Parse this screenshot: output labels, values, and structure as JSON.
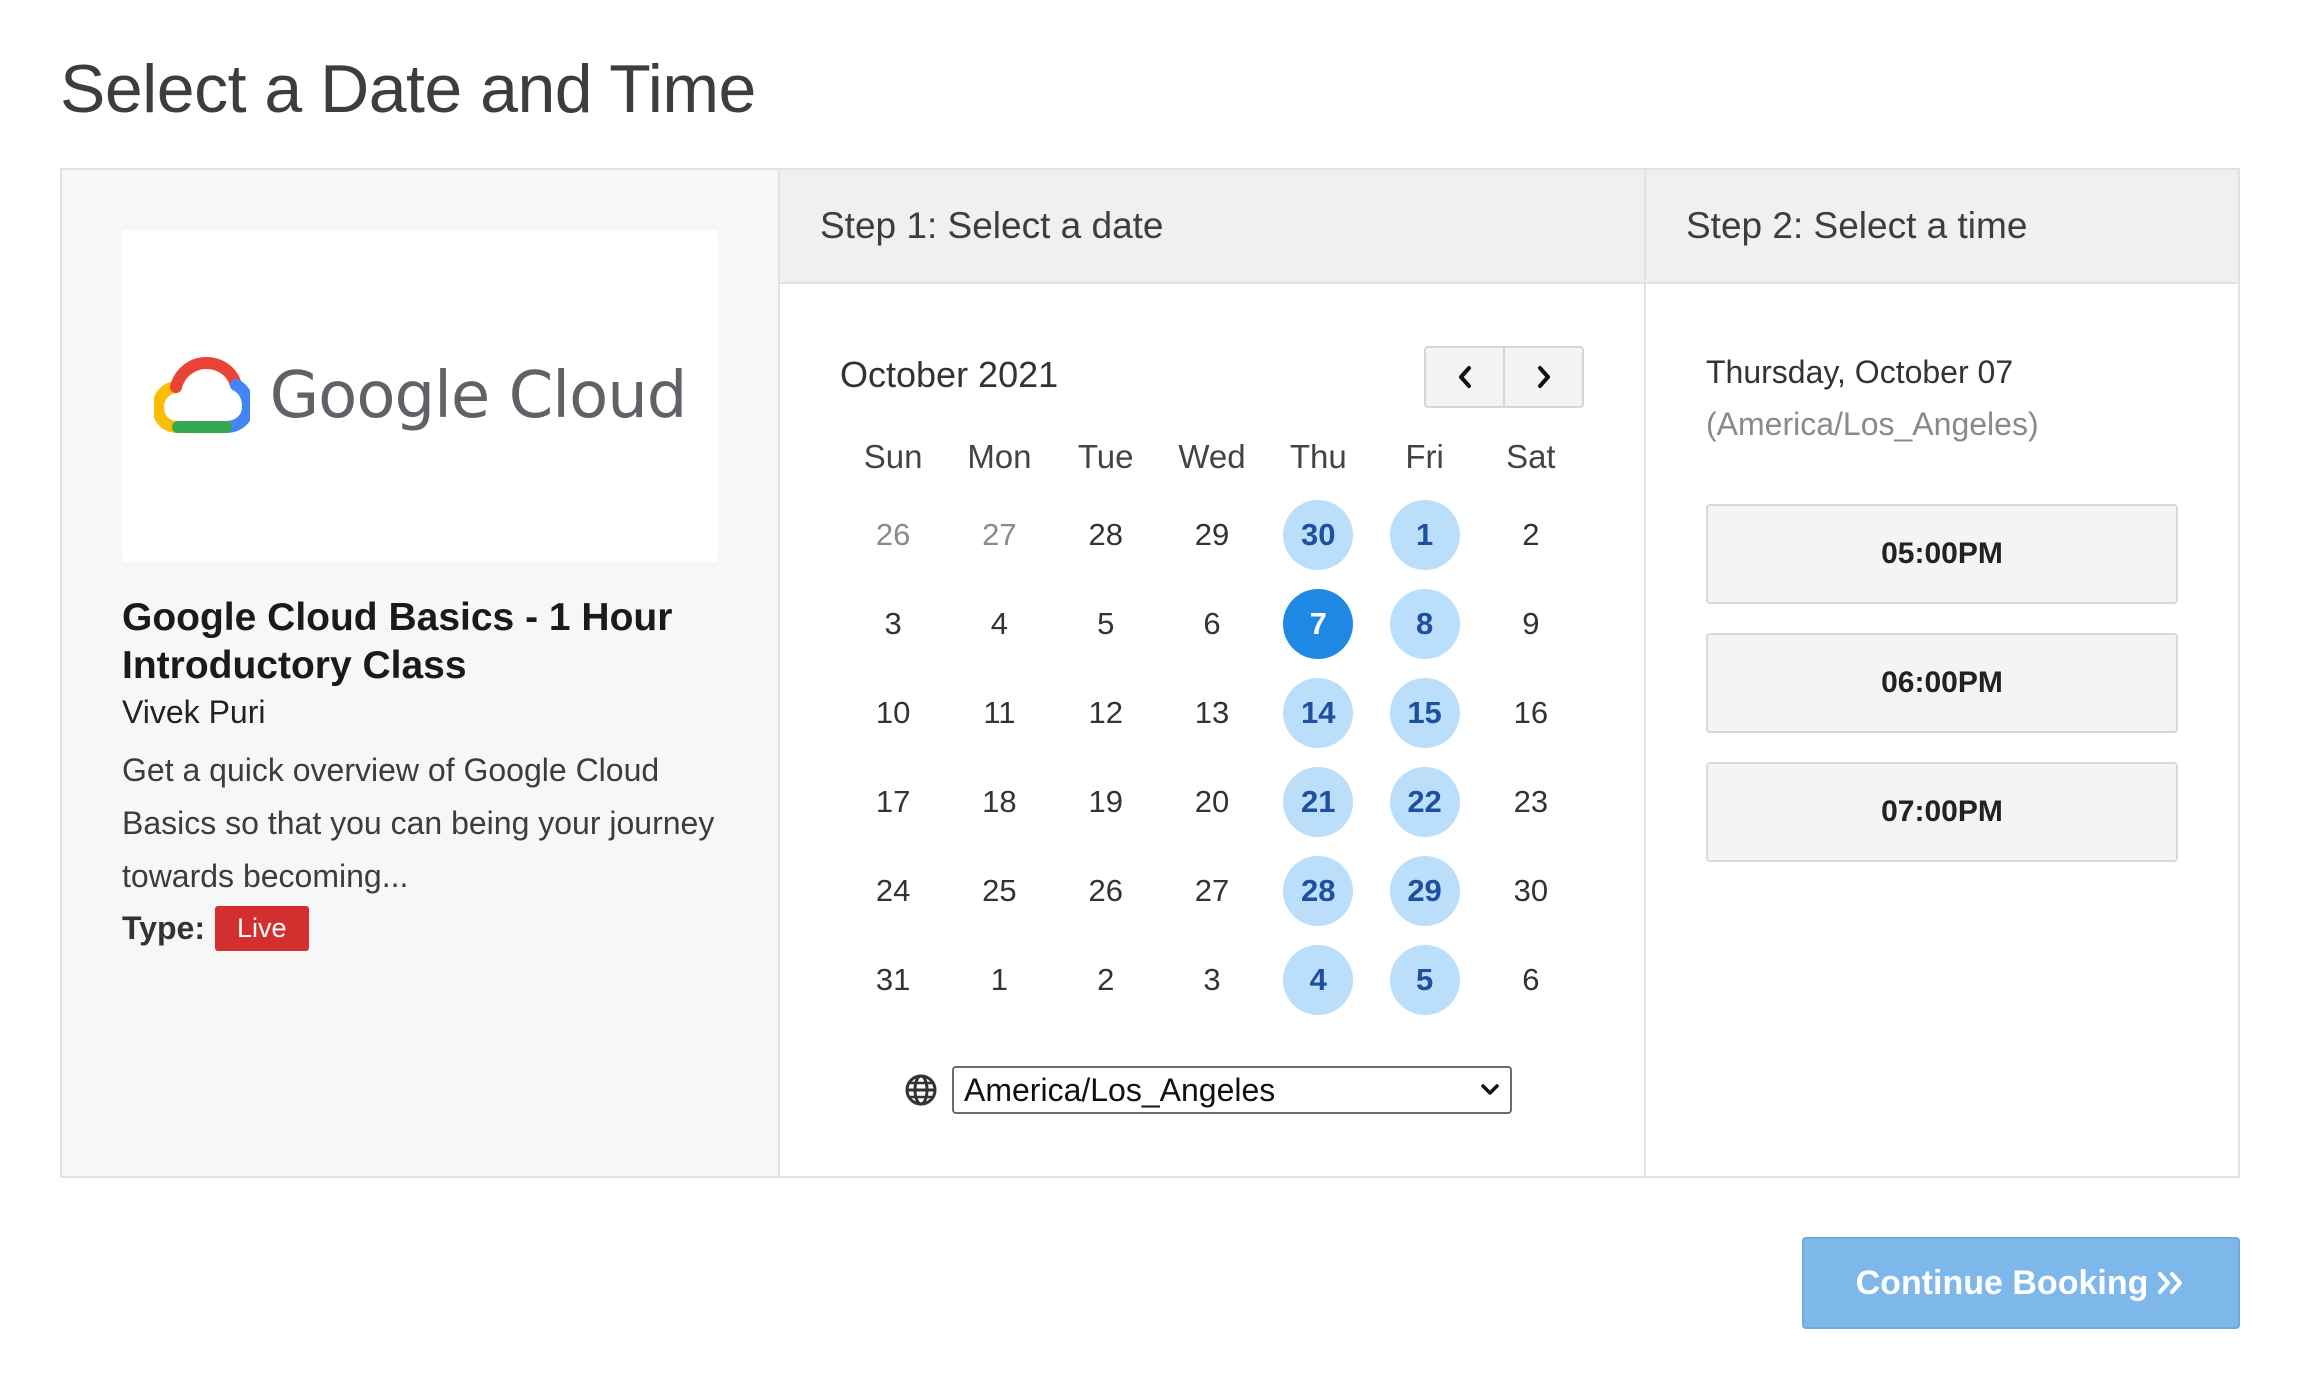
{
  "page": {
    "title": "Select a Date and Time"
  },
  "event": {
    "logo_text": "Google Cloud",
    "title": "Google Cloud Basics - 1 Hour Introductory Class",
    "host": "Vivek Puri",
    "description": "Get a quick overview of Google Cloud Basics so that you can being your journey towards becoming...",
    "type_label": "Type:",
    "type_value": "Live"
  },
  "date_step": {
    "heading": "Step 1: Select a date",
    "month_label": "October 2021",
    "weekdays": [
      "Sun",
      "Mon",
      "Tue",
      "Wed",
      "Thu",
      "Fri",
      "Sat"
    ],
    "days": [
      {
        "label": "26",
        "state": "muted"
      },
      {
        "label": "27",
        "state": "muted"
      },
      {
        "label": "28",
        "state": "normal"
      },
      {
        "label": "29",
        "state": "normal"
      },
      {
        "label": "30",
        "state": "available"
      },
      {
        "label": "1",
        "state": "available"
      },
      {
        "label": "2",
        "state": "normal"
      },
      {
        "label": "3",
        "state": "normal"
      },
      {
        "label": "4",
        "state": "normal"
      },
      {
        "label": "5",
        "state": "normal"
      },
      {
        "label": "6",
        "state": "normal"
      },
      {
        "label": "7",
        "state": "selected"
      },
      {
        "label": "8",
        "state": "available"
      },
      {
        "label": "9",
        "state": "normal"
      },
      {
        "label": "10",
        "state": "normal"
      },
      {
        "label": "11",
        "state": "normal"
      },
      {
        "label": "12",
        "state": "normal"
      },
      {
        "label": "13",
        "state": "normal"
      },
      {
        "label": "14",
        "state": "available"
      },
      {
        "label": "15",
        "state": "available"
      },
      {
        "label": "16",
        "state": "normal"
      },
      {
        "label": "17",
        "state": "normal"
      },
      {
        "label": "18",
        "state": "normal"
      },
      {
        "label": "19",
        "state": "normal"
      },
      {
        "label": "20",
        "state": "normal"
      },
      {
        "label": "21",
        "state": "available"
      },
      {
        "label": "22",
        "state": "available"
      },
      {
        "label": "23",
        "state": "normal"
      },
      {
        "label": "24",
        "state": "normal"
      },
      {
        "label": "25",
        "state": "normal"
      },
      {
        "label": "26",
        "state": "normal"
      },
      {
        "label": "27",
        "state": "normal"
      },
      {
        "label": "28",
        "state": "available"
      },
      {
        "label": "29",
        "state": "available"
      },
      {
        "label": "30",
        "state": "normal"
      },
      {
        "label": "31",
        "state": "normal"
      },
      {
        "label": "1",
        "state": "normal"
      },
      {
        "label": "2",
        "state": "normal"
      },
      {
        "label": "3",
        "state": "normal"
      },
      {
        "label": "4",
        "state": "available"
      },
      {
        "label": "5",
        "state": "available"
      },
      {
        "label": "6",
        "state": "normal"
      }
    ],
    "timezone_value": "America/Los_Angeles",
    "icons": {
      "prev": "chevron-left-icon",
      "next": "chevron-right-icon",
      "timezone": "globe-icon",
      "dropdown": "chevron-down-icon"
    }
  },
  "time_step": {
    "heading": "Step 2: Select a time",
    "selected_date": "Thursday, October 07",
    "selected_timezone": "(America/Los_Angeles)",
    "slots": [
      "05:00PM",
      "06:00PM",
      "07:00PM"
    ]
  },
  "footer": {
    "continue_label": "Continue Booking"
  },
  "colors": {
    "available_bg": "#bbdefb",
    "available_text": "#1f4fa0",
    "selected_bg": "#1e88e5",
    "badge_bg": "#d32f2f",
    "continue_bg": "#7eb7ea"
  }
}
